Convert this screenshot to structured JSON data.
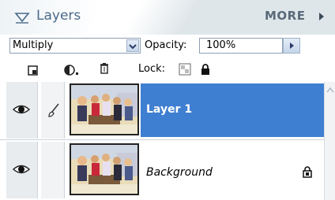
{
  "panel": {
    "title": "Layers",
    "more_label": "MORE"
  },
  "blend": {
    "mode": "Multiply",
    "opacity_label": "Opacity:",
    "opacity_value": "100%"
  },
  "tools": {
    "lock_label": "Lock:"
  },
  "layers": [
    {
      "name": "Layer 1",
      "selected": true,
      "visible": true
    },
    {
      "name": "Background",
      "selected": false,
      "visible": true,
      "locked": true
    }
  ],
  "colors": {
    "selection": "#3f7fd1",
    "header_text": "#4a6a8a"
  },
  "icons": [
    "collapse-triangle-icon",
    "more-arrow-icon",
    "new-layer-icon",
    "adjustment-layer-icon",
    "trash-icon",
    "lock-transparency-icon",
    "lock-all-icon",
    "eye-icon",
    "brush-icon",
    "lock-icon",
    "scroll-up-icon"
  ]
}
